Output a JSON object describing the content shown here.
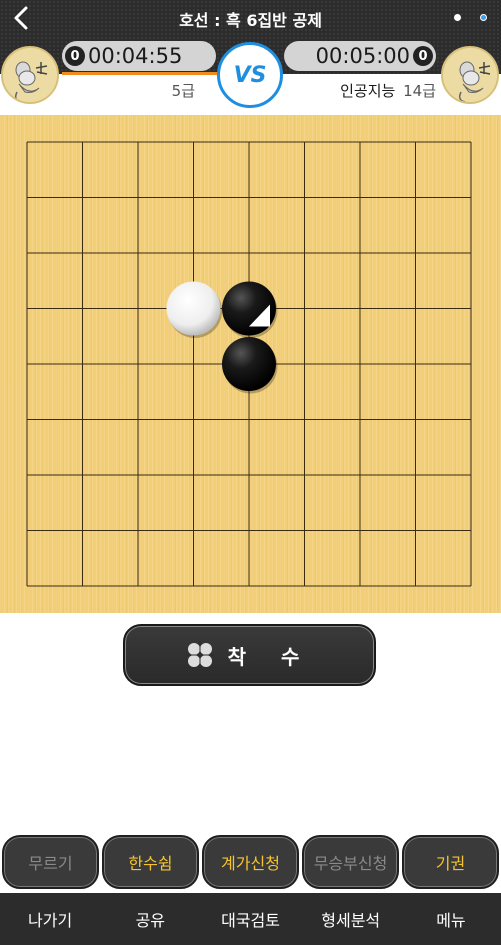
{
  "header": {
    "title": "호선 : 흑 6집반 공제",
    "vs_label": "VS",
    "left_player": {
      "byoyomi": "0",
      "time": "00:04:55",
      "rank": "5급",
      "turn_color": "#f28a1d"
    },
    "right_player": {
      "byoyomi": "0",
      "time": "00:05:00",
      "name": "인공지능",
      "rank": "14급"
    }
  },
  "board": {
    "size": 9,
    "background": "#f2cf77",
    "stones": [
      {
        "color": "white",
        "col": 3,
        "row": 3
      },
      {
        "color": "black",
        "col": 4,
        "row": 3,
        "last_move": true
      },
      {
        "color": "black",
        "col": 4,
        "row": 4
      }
    ]
  },
  "move_button": {
    "label": "착 수",
    "icon": "stones-icon"
  },
  "actions": [
    {
      "label": "무르기",
      "state": "disabled"
    },
    {
      "label": "한수쉼",
      "state": "enabled"
    },
    {
      "label": "계가신청",
      "state": "enabled"
    },
    {
      "label": "무승부신청",
      "state": "disabled"
    },
    {
      "label": "기권",
      "state": "enabled"
    }
  ],
  "nav": [
    "나가기",
    "공유",
    "대국검토",
    "형세분석",
    "메뉴"
  ],
  "colors": {
    "accent": "#1e8fe0",
    "enabled_text": "#f4c430",
    "disabled_text": "#8a8a8a"
  }
}
